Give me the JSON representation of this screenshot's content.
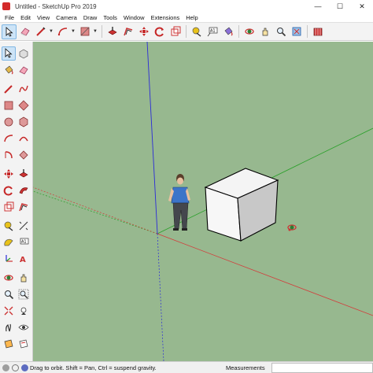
{
  "window": {
    "title": "Untitled - SketchUp Pro 2019",
    "minimize_glyph": "—",
    "maximize_glyph": "☐",
    "close_glyph": "✕"
  },
  "menu": [
    "File",
    "Edit",
    "View",
    "Camera",
    "Draw",
    "Tools",
    "Window",
    "Extensions",
    "Help"
  ],
  "toolbar": {
    "icons": [
      "select-icon",
      "eraser-icon",
      "line-icon",
      "arc-icon",
      "rectangle-icon",
      "push-pull-icon",
      "offset-icon",
      "move-icon",
      "rotate-icon",
      "scale-icon",
      "tape-measure-icon",
      "text-icon",
      "paint-bucket-icon",
      "orbit-icon",
      "pan-icon",
      "zoom-icon",
      "zoom-extents-icon",
      "warehouse-icon"
    ]
  },
  "left_toolbar": {
    "icons": [
      "select-icon",
      "make-component-icon",
      "paint-bucket-icon",
      "eraser-icon",
      "line-icon",
      "freehand-icon",
      "rectangle-icon",
      "rotated-rectangle-icon",
      "circle-icon",
      "polygon-icon",
      "arc-icon",
      "two-point-arc-icon",
      "pie-icon",
      "three-point-arc-icon",
      "move-icon",
      "push-pull-icon",
      "rotate-icon",
      "follow-me-icon",
      "scale-icon",
      "offset-icon",
      "tape-measure-icon",
      "dimension-icon",
      "protractor-icon",
      "text-icon",
      "axes-icon",
      "3d-text-icon",
      "orbit-icon",
      "pan-icon",
      "zoom-icon",
      "zoom-window-icon",
      "zoom-extents-icon",
      "position-camera-icon",
      "walk-icon",
      "look-around-icon",
      "section-plane-icon",
      "display-section-icon"
    ]
  },
  "status": {
    "hint": "Drag to orbit. Shift = Pan, Ctrl = suspend gravity.",
    "measurements_label": "Measurements",
    "measurements_value": ""
  },
  "colors": {
    "viewport_bg": "#97b88f",
    "axis_red": "#d43a3a",
    "axis_green": "#2aa02a",
    "axis_blue": "#2b2bd8",
    "toolbar_bg": "#f3f3f3",
    "active_tool": "#cde4f7"
  }
}
